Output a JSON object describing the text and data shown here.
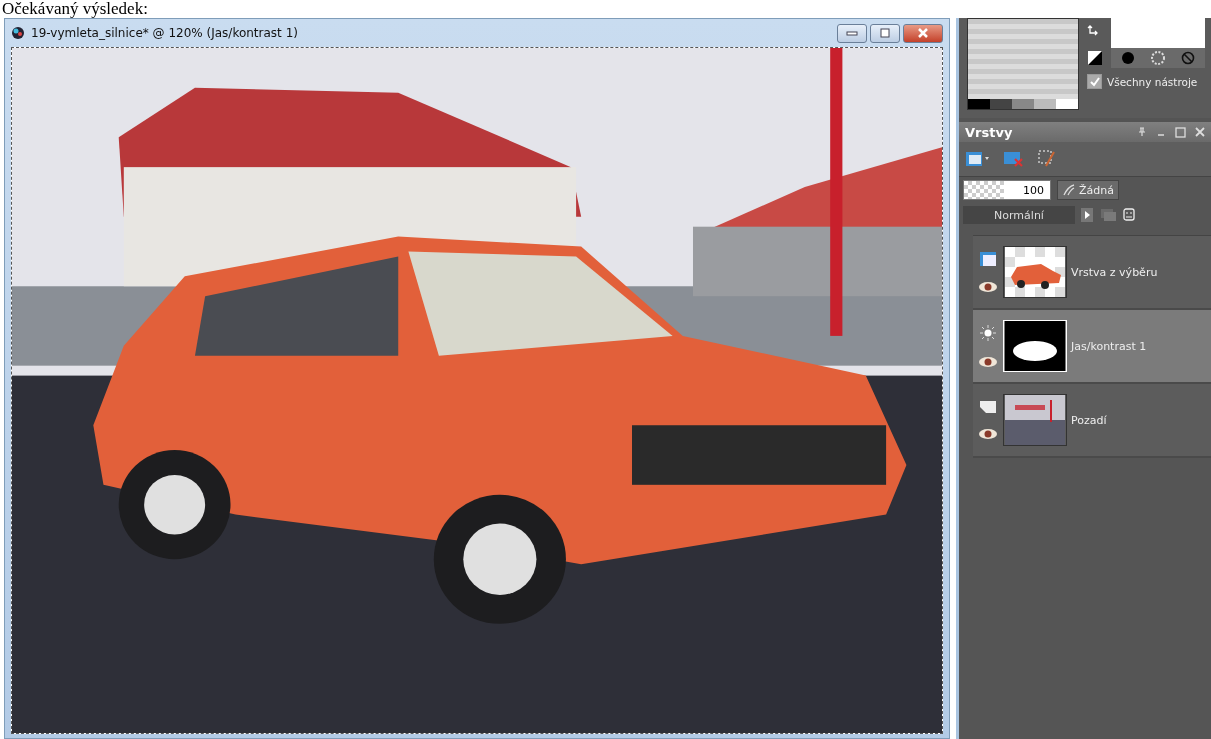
{
  "caption": "Očekávaný výsledek:",
  "window": {
    "title": "19-vymleta_silnice* @ 120% (Jas/kontrast 1)"
  },
  "materials": {
    "all_tools": {
      "label": "Všechny nástroje",
      "checked": true
    }
  },
  "layers_panel": {
    "title": "Vrstvy",
    "opacity": "100",
    "blend_button": "Žádná",
    "blend_mode": "Normální",
    "layers": [
      {
        "name": "Vrstva z výběru",
        "kind": "raster",
        "selected": false
      },
      {
        "name": "Jas/kontrast 1",
        "kind": "adjustment",
        "selected": true
      },
      {
        "name": "Pozadí",
        "kind": "background",
        "selected": false
      }
    ]
  }
}
